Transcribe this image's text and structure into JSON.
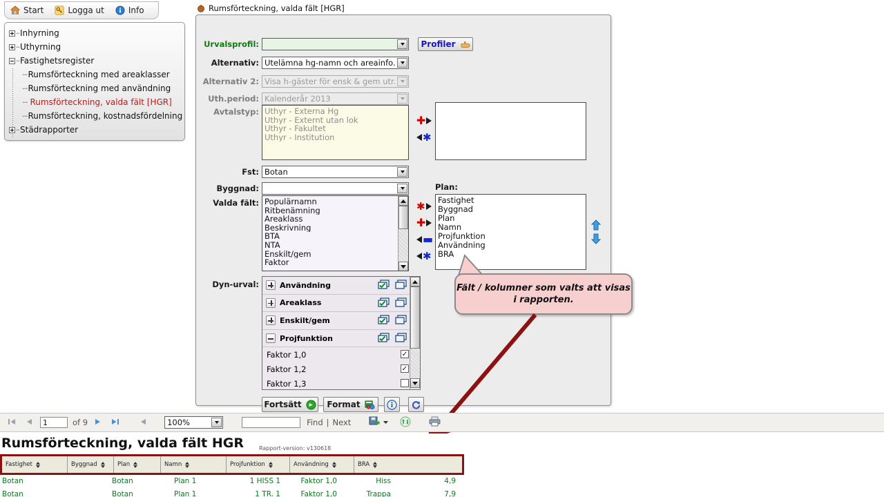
{
  "taskbar": {
    "items": [
      {
        "label": "Start",
        "icon": "home-icon"
      },
      {
        "label": "Logga ut",
        "icon": "key-icon"
      },
      {
        "label": "Info",
        "icon": "info-icon"
      }
    ]
  },
  "tree": {
    "nodes": [
      {
        "label": "Inhyrning",
        "state": "collapsed",
        "level": 0
      },
      {
        "label": "Uthyrning",
        "state": "collapsed",
        "level": 0
      },
      {
        "label": "Fastighetsregister",
        "state": "expanded",
        "level": 0
      },
      {
        "label": "Rumsförteckning med areaklasser",
        "state": "leaf",
        "level": 1
      },
      {
        "label": "Rumsförteckning med användning",
        "state": "leaf",
        "level": 1
      },
      {
        "label": "Rumsförteckning, valda fält [HGR]",
        "state": "leaf-selected",
        "level": 1
      },
      {
        "label": "Rumsförteckning, kostnadsfördelning",
        "state": "leaf",
        "level": 1
      },
      {
        "label": "Städrapporter",
        "state": "collapsed",
        "level": 0
      }
    ],
    "selected_color": "#d01010"
  },
  "window": {
    "title": "Rumsförteckning, valda fält [HGR]",
    "icon": "app-icon"
  },
  "form": {
    "urvalsprofil": {
      "label": "Urvalsprofil:",
      "value": "",
      "disabled": false
    },
    "alternativ": {
      "label": "Alternativ:",
      "value": "Utelämna hg-namn och areainfo.",
      "disabled": false
    },
    "alternativ2": {
      "label": "Alternativ 2:",
      "value": "Visa h-gäster för ensk & gem utr.",
      "disabled": true
    },
    "uthperiod": {
      "label": "Uth.period:",
      "value": "Kalenderår 2013",
      "disabled": true
    },
    "avtalstyp": {
      "label": "Avtalstyp:",
      "options": [
        "Uthyr - Externa Hg",
        "Uthyr - Externt utan lok",
        "Uthyr - Fakultet",
        "Uthyr - Institution"
      ],
      "selected": []
    },
    "fst": {
      "label": "Fst:",
      "value": "Botan"
    },
    "byggnad": {
      "label": "Byggnad:",
      "value": ""
    },
    "plan": {
      "label": "Plan:"
    },
    "valda_falt": {
      "label": "Valda fält:",
      "available": [
        "Populärnamn",
        "Ritbenämning",
        "Areaklass",
        "Beskrivning",
        "BTA",
        "NTA",
        "Enskilt/gem",
        "Faktor"
      ],
      "chosen": [
        "Fastighet",
        "Byggnad",
        "Plan",
        "Namn",
        "Projfunktion",
        "Användning",
        "BRA"
      ]
    },
    "dyn_urval": {
      "label": "Dyn-urval:",
      "groups": [
        {
          "label": "Användning",
          "state": "collapsed"
        },
        {
          "label": "Areaklass",
          "state": "collapsed"
        },
        {
          "label": "Enskilt/gem",
          "state": "collapsed"
        },
        {
          "label": "Projfunktion",
          "state": "expanded"
        }
      ],
      "items": [
        {
          "label": "Faktor 1,0",
          "checked": true
        },
        {
          "label": "Faktor 1,2",
          "checked": true
        },
        {
          "label": "Faktor 1,3",
          "checked": false
        }
      ]
    },
    "profiler_button": "Profiler",
    "transfer_buttons": [
      {
        "name": "add-all-button",
        "glyph": "star-right"
      },
      {
        "name": "add-selected-button",
        "glyph": "plus-right"
      },
      {
        "name": "remove-selected-button",
        "glyph": "left-minus"
      },
      {
        "name": "remove-all-button",
        "glyph": "left-star"
      }
    ],
    "reorder_buttons": [
      {
        "name": "move-up-button",
        "glyph": "arrow-up"
      },
      {
        "name": "move-down-button",
        "glyph": "arrow-down"
      }
    ],
    "buttons": [
      {
        "label": "Fortsätt",
        "icon": "green-arrow-icon",
        "name": "continue-button"
      },
      {
        "label": "Format",
        "icon": "excel-icon",
        "name": "format-button"
      },
      {
        "label": "",
        "icon": "info-icon",
        "name": "info-button"
      },
      {
        "label": "",
        "icon": "refresh-icon",
        "name": "reset-button"
      }
    ]
  },
  "callout": {
    "text": "Fält / kolumner som valts att visas i rapporten.",
    "background": "#f8cfcf"
  },
  "report_toolbar": {
    "first_page_icon": "first-page-icon",
    "prev_page_icon": "prev-page-icon",
    "page_value": "1",
    "of_label": "of 9",
    "next_page_icon": "next-page-icon",
    "last_page_icon": "last-page-icon",
    "back_icon": "back-icon",
    "zoom_value": "100%",
    "search_value": "",
    "find_label": "Find",
    "separator": "|",
    "next_label": "Next",
    "export_icon": "export-icon",
    "refresh_icon": "refresh-icon",
    "print_icon": "print-icon"
  },
  "report": {
    "title": "Rumsförteckning, valda fält HGR",
    "version": "Rapport-version: v130618",
    "columns": [
      "Fastighet",
      "Byggnad",
      "Plan",
      "Namn",
      "Projfunktion",
      "Användning",
      "BRA"
    ],
    "rows": [
      [
        "Botan",
        "Botan",
        "Plan 1",
        "1 HISS 1",
        "Faktor 1,0",
        "Hiss",
        "4,9"
      ],
      [
        "Botan",
        "Botan",
        "Plan 1",
        "1 TR. 1",
        "Faktor 1,0",
        "Trappa",
        "7,9"
      ]
    ],
    "highlight_color": "#8c1111",
    "text_color": "#0a7a1e"
  }
}
